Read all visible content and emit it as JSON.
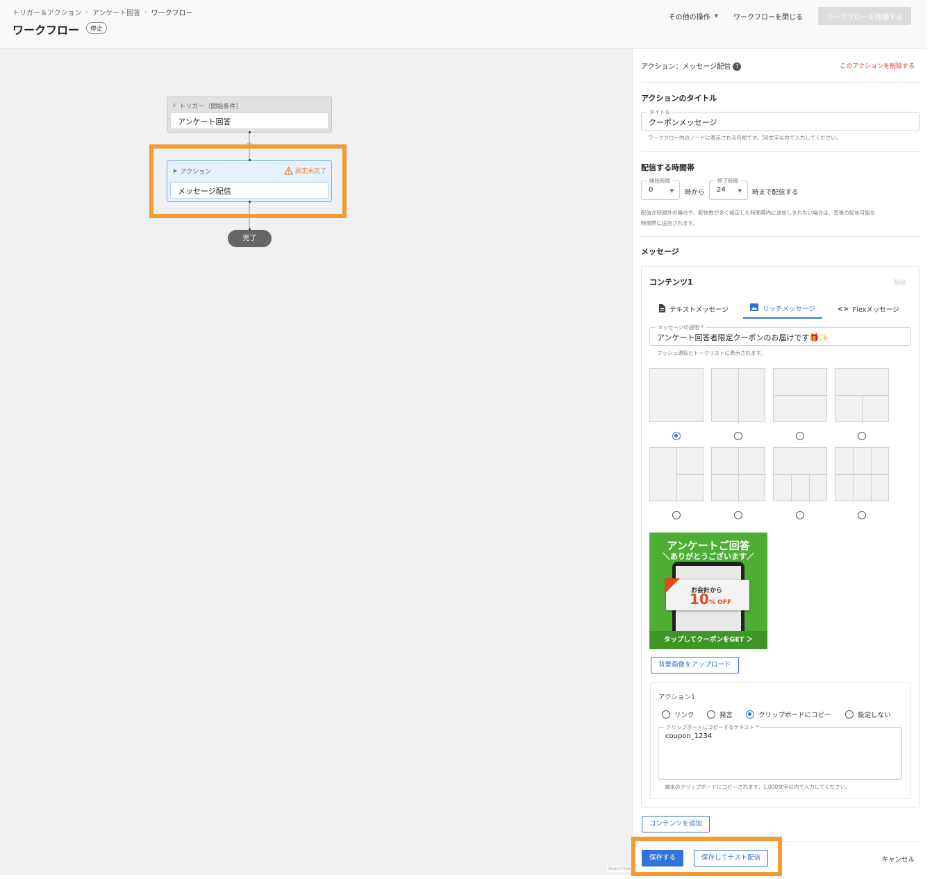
{
  "header": {
    "breadcrumb": [
      "トリガー＆アクション",
      "アンケート回答",
      "ワークフロー"
    ],
    "title": "ワークフロー",
    "status": "停止",
    "other_ops": "その他の操作",
    "close": "ワークフローを閉じる",
    "activate": "ワークフローを稼働する"
  },
  "canvas": {
    "trigger_label": "トリガー（開始条件）",
    "trigger_value": "アンケート回答",
    "action_label": "アクション",
    "action_warning": "設定未完了",
    "action_value": "メッセージ配信",
    "end_label": "完了",
    "react_flow": "React Flow"
  },
  "panel": {
    "heading": "アクション：メッセージ配信",
    "delete_action": "このアクションを削除する",
    "title_section": "アクションのタイトル",
    "title_legend": "タイトル",
    "title_value": "クーポンメッセージ",
    "title_hint": "ワークフロー内のノードに表示される名前です。50文字以内で入力してください。",
    "time_section": "配信する時間帯",
    "start_legend": "開始時間",
    "start_value": "0",
    "from_text": "時から",
    "end_legend": "終了時間",
    "end_value": "24",
    "until_text": "時まで配信する",
    "time_hint1": "配信が時間外の場合や、配信数が多く設定した時間帯内に送信しきれない場合は、直後の配信可能な",
    "time_hint2": "時間帯に送信されます。",
    "message_section": "メッセージ",
    "content_title": "コンテンツ1",
    "content_delete": "削除",
    "tabs": [
      "テキストメッセージ",
      "リッチメッセージ",
      "Flexメッセージ"
    ],
    "desc_legend": "メッセージの説明 *",
    "desc_value": "アンケート回答者限定クーポンのお届けです🎁✨",
    "desc_hint": "プッシュ通知とトークリストに表示されます。",
    "selected_layout_index": 0,
    "upload_bg": "背景画像をアップロード",
    "action1_title": "アクション1",
    "action_types": [
      "リンク",
      "発言",
      "クリップボードにコピー",
      "設定しない"
    ],
    "action_selected": "クリップボードにコピー",
    "copy_legend": "クリップボードにコピーするテキスト *",
    "copy_value": "coupon_1234",
    "copy_hint": "端末のクリップボードにコピーされます。1,000文字以内で入力してください。",
    "add_content": "コンテンツを追加",
    "save": "保存する",
    "save_test": "保存してテスト配信",
    "cancel": "キャンセル"
  },
  "rich_image": {
    "line1": "アンケートご回答",
    "line2": "＼ありがとうございます／",
    "coupon_line": "お会計から",
    "coupon_big": "10",
    "coupon_off": "% OFF",
    "bar": "タップしてクーポンをGET ＞"
  },
  "colors": {
    "accent": "#3174d8",
    "highlight": "#f39c34",
    "warning": "#e0863a",
    "danger": "#e0372f"
  }
}
